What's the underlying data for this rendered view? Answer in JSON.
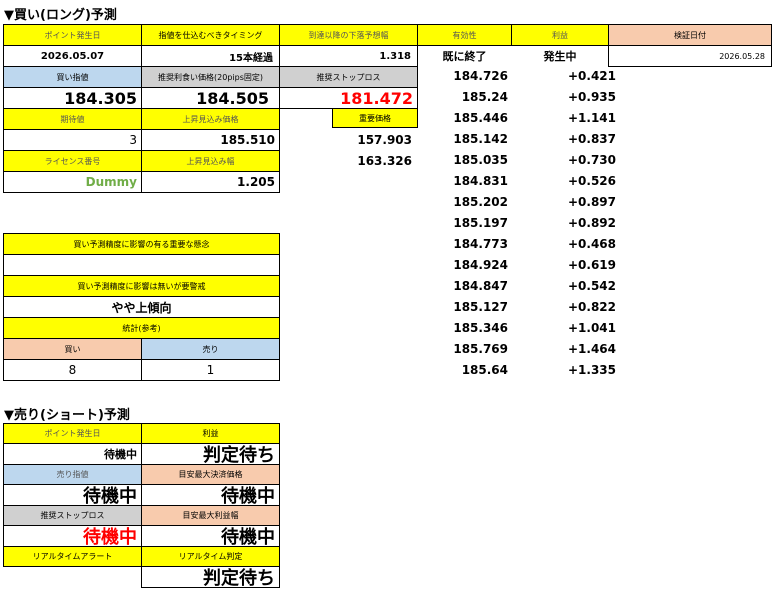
{
  "long": {
    "title": "▼買い(ロング)予測",
    "headers": {
      "point_date": "ポイント発生日",
      "entry_timing": "指値を仕込むべきタイミング",
      "expected_drop": "到達以降の下落予想幅",
      "validity": "有効性",
      "profit": "利益",
      "verify_date": "検証日付"
    },
    "values": {
      "point_date": "2026.05.07",
      "entry_timing": "15本経過",
      "expected_drop": "1.318",
      "validity": "既に終了",
      "profit": "発生中",
      "verify_date": "2026.05.28"
    },
    "headers2": {
      "buy_limit": "買い指値",
      "tp_price": "推奨利食い価格(20pips固定)",
      "stop_loss": "推奨ストップロス"
    },
    "values2": {
      "buy_limit": "184.305",
      "tp_price": "184.505",
      "stop_loss": "181.472"
    },
    "headers3": {
      "expectation": "期待値",
      "upside_price": "上昇見込み価格",
      "important_price": "重要価格"
    },
    "values3": {
      "expectation": "3",
      "upside_price": "185.510",
      "important_price_1": "157.903",
      "important_price_2": "163.326"
    },
    "headers4": {
      "license": "ライセンス番号",
      "upside_width": "上昇見込み幅"
    },
    "values4": {
      "license": "Dummy",
      "upside_width": "1.205"
    },
    "influence_label": "買い予測精度に影響の有る重要な懸念",
    "influence_value": "",
    "no_influence_label": "買い予測精度に影響は無いが要警戒",
    "no_influence_value": "やや上傾向",
    "stats_label": "統計(参考)",
    "stats_buy_label": "買い",
    "stats_sell_label": "売り",
    "stats_buy_value": "8",
    "stats_sell_value": "1",
    "price_list": [
      {
        "price": "184.726",
        "profit": "+0.421"
      },
      {
        "price": "185.24",
        "profit": "+0.935"
      },
      {
        "price": "185.446",
        "profit": "+1.141"
      },
      {
        "price": "185.142",
        "profit": "+0.837"
      },
      {
        "price": "185.035",
        "profit": "+0.730"
      },
      {
        "price": "184.831",
        "profit": "+0.526"
      },
      {
        "price": "185.202",
        "profit": "+0.897"
      },
      {
        "price": "185.197",
        "profit": "+0.892"
      },
      {
        "price": "184.773",
        "profit": "+0.468"
      },
      {
        "price": "184.924",
        "profit": "+0.619"
      },
      {
        "price": "184.847",
        "profit": "+0.542"
      },
      {
        "price": "185.127",
        "profit": "+0.822"
      },
      {
        "price": "185.346",
        "profit": "+1.041"
      },
      {
        "price": "185.769",
        "profit": "+1.464"
      },
      {
        "price": "185.64",
        "profit": "+1.335"
      }
    ]
  },
  "short": {
    "title": "▼売り(ショート)予測",
    "headers": {
      "point_date": "ポイント発生日",
      "profit": "利益"
    },
    "values": {
      "point_date": "待機中",
      "profit": "判定待ち"
    },
    "headers2": {
      "sell_limit": "売り指値",
      "max_settle": "目安最大決済価格"
    },
    "values2": {
      "sell_limit": "待機中",
      "max_settle": "待機中"
    },
    "headers3": {
      "stop_loss": "推奨ストップロス",
      "max_profit": "目安最大利益幅"
    },
    "values3": {
      "stop_loss": "待機中",
      "max_profit": "待機中"
    },
    "headers4": {
      "realtime_alert": "リアルタイムアラート",
      "realtime_judge": "リアルタイム判定"
    },
    "values4": {
      "realtime_alert": "",
      "realtime_judge": "判定待ち"
    }
  },
  "colors": {
    "header_yellow": "#ffff00",
    "header_blue": "#bdd7ee",
    "header_gray": "#d0d0d0",
    "header_peach": "#f8cbad",
    "stop_loss_red": "#ff0000",
    "license_green": "#70ad47"
  }
}
